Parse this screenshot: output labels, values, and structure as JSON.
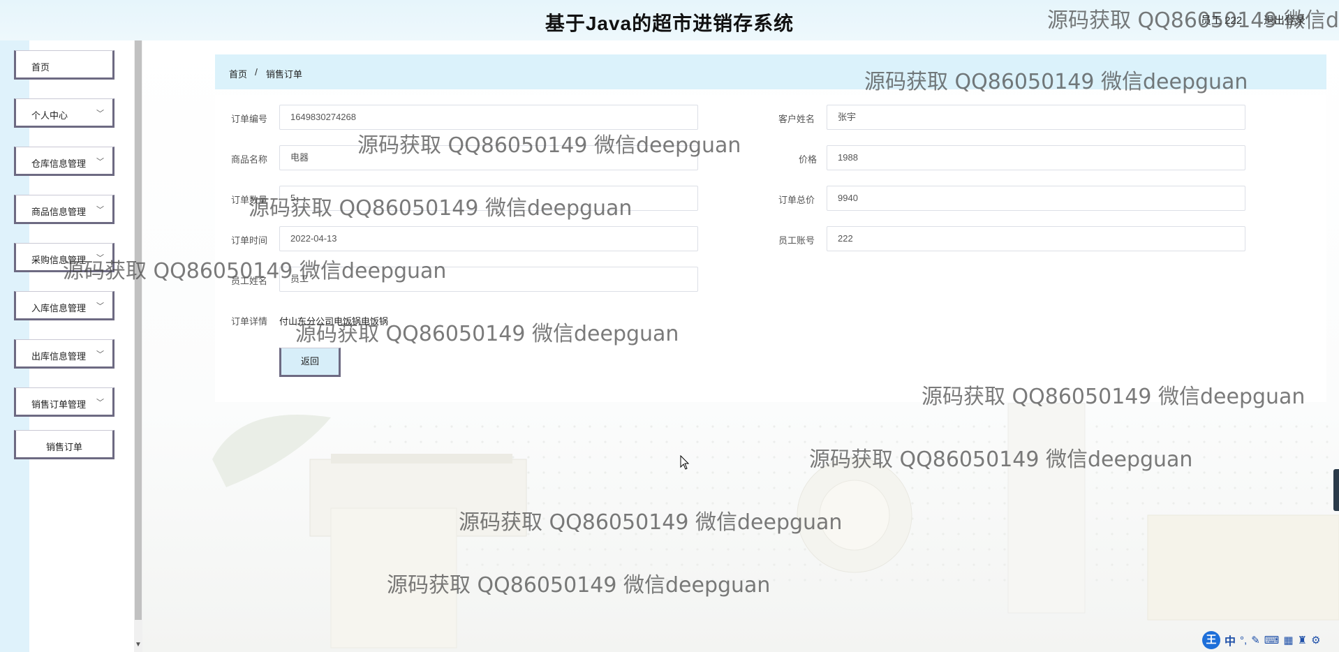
{
  "header": {
    "title": "基于Java的超市进销存系统",
    "user_label": "员工 222",
    "logout_label": "退出登录"
  },
  "sidebar": {
    "items": [
      {
        "label": "首页",
        "has_arrow": false
      },
      {
        "label": "个人中心",
        "has_arrow": true
      },
      {
        "label": "仓库信息管理",
        "has_arrow": true
      },
      {
        "label": "商品信息管理",
        "has_arrow": true
      },
      {
        "label": "采购信息管理",
        "has_arrow": true
      },
      {
        "label": "入库信息管理",
        "has_arrow": true
      },
      {
        "label": "出库信息管理",
        "has_arrow": true
      },
      {
        "label": "销售订单管理",
        "has_arrow": true
      },
      {
        "label": "销售订单",
        "has_arrow": false
      }
    ],
    "arrow_icon": "chevron-down-icon"
  },
  "breadcrumb": {
    "home": "首页",
    "separator": "/",
    "current": "销售订单"
  },
  "form": {
    "order_no": {
      "label": "订单编号",
      "value": "1649830274268"
    },
    "customer_name": {
      "label": "客户姓名",
      "value": "张宇"
    },
    "product_name": {
      "label": "商品名称",
      "value": "电器"
    },
    "price": {
      "label": "价格",
      "value": "1988"
    },
    "order_qty": {
      "label": "订单数量",
      "value": "5"
    },
    "order_total": {
      "label": "订单总价",
      "value": "9940"
    },
    "order_time": {
      "label": "订单时间",
      "value": "2022-04-13"
    },
    "staff_account": {
      "label": "员工账号",
      "value": "222"
    },
    "staff_name": {
      "label": "员工姓名",
      "value": "员工"
    },
    "order_detail": {
      "label": "订单详情",
      "value": "付山东分公司电饭锅电饭锅"
    },
    "back_label": "返回"
  },
  "watermark": {
    "text": "源码获取 QQ86050149 微信deepguan"
  },
  "ime": {
    "logo": "王",
    "mode": "中",
    "icons": [
      "punctuation-icon",
      "pen-icon",
      "keyboard-icon",
      "grid-icon",
      "shirt-icon",
      "gear-icon"
    ]
  },
  "colors": {
    "breadcrumb_bg": "#dbf2fb",
    "menu_border": "#6d6a82",
    "header_bg": "#e6f5fb"
  }
}
